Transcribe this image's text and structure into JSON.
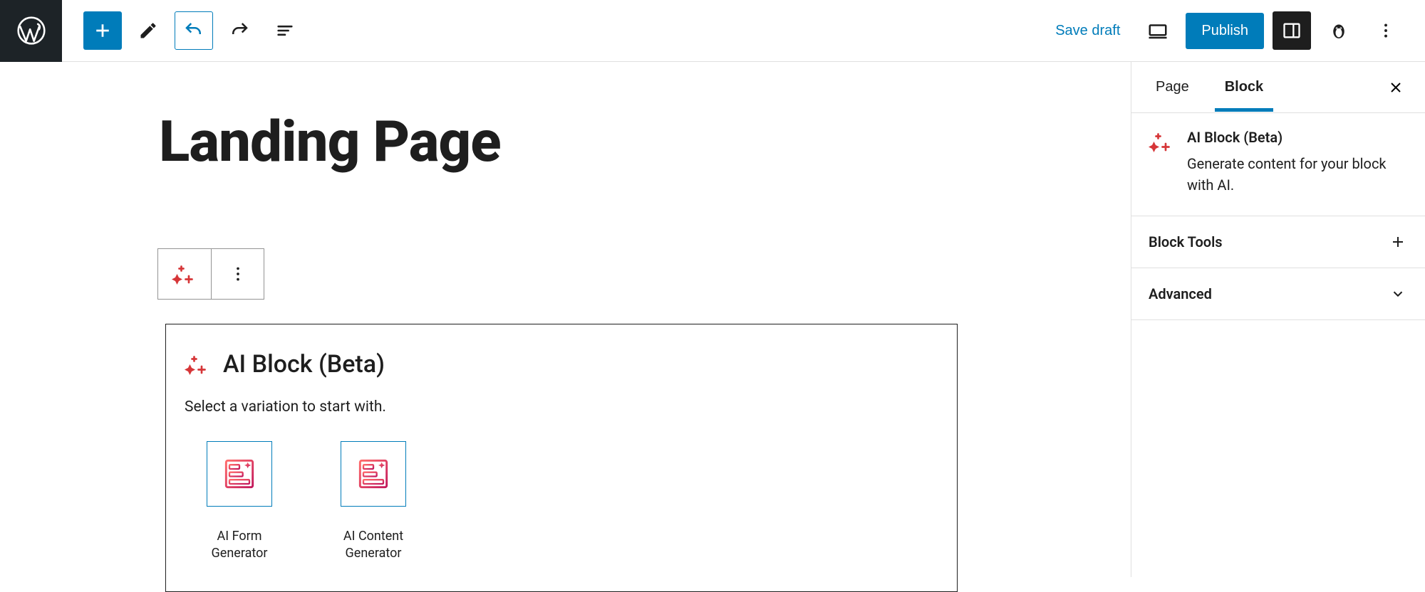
{
  "toolbar": {
    "save_draft": "Save draft",
    "publish": "Publish"
  },
  "editor": {
    "page_title": "Landing Page"
  },
  "block": {
    "title": "AI Block (Beta)",
    "subtitle": "Select a variation to start with.",
    "variations": [
      {
        "label": "AI Form Generator"
      },
      {
        "label": "AI Content Generator"
      }
    ]
  },
  "sidebar": {
    "tabs": {
      "page": "Page",
      "block": "Block"
    },
    "block_info": {
      "title": "AI Block (Beta)",
      "desc": "Generate content for your block with AI."
    },
    "panels": {
      "block_tools": "Block Tools",
      "advanced": "Advanced"
    }
  }
}
